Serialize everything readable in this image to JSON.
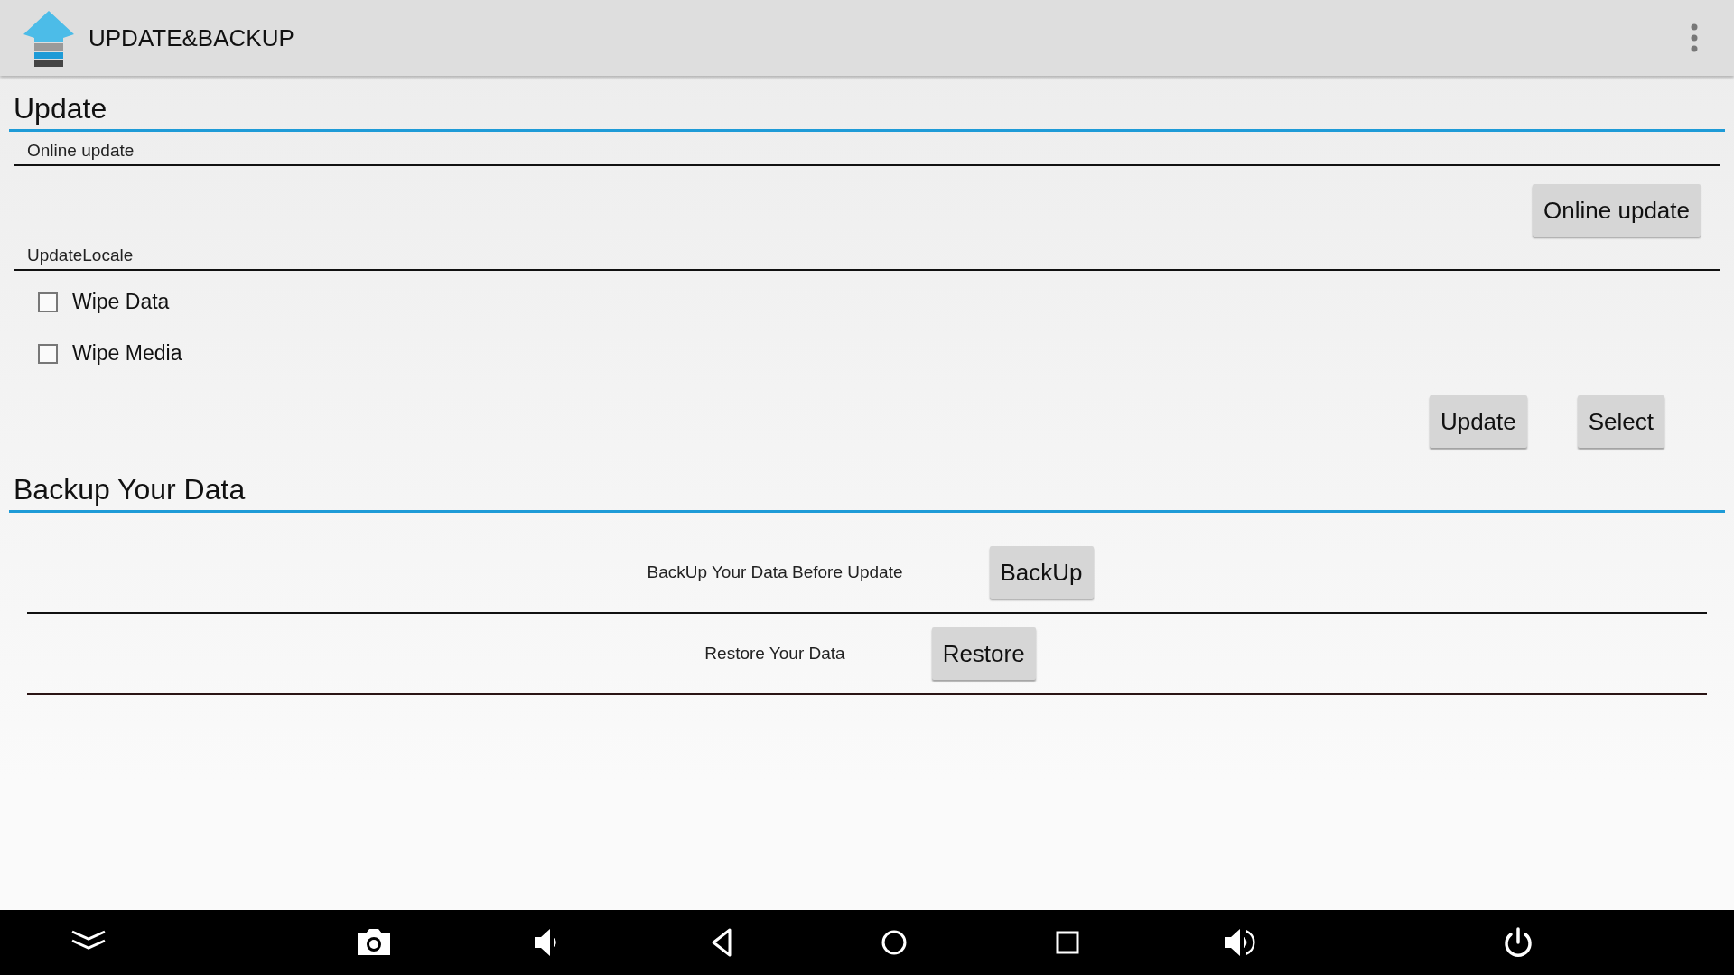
{
  "app_bar": {
    "title": "UPDATE&BACKUP"
  },
  "update_section": {
    "heading": "Update",
    "online": {
      "label": "Online update",
      "button": "Online update"
    },
    "locale": {
      "label": "UpdateLocale",
      "options": [
        {
          "label": "Wipe Data",
          "checked": false
        },
        {
          "label": "Wipe Media",
          "checked": false
        }
      ],
      "buttons": [
        "Update",
        "Select"
      ]
    }
  },
  "backup_section": {
    "heading": "Backup Your Data",
    "rows": [
      {
        "text": "BackUp Your Data Before Update",
        "button": "BackUp"
      },
      {
        "text": "Restore Your Data",
        "button": "Restore"
      }
    ]
  }
}
